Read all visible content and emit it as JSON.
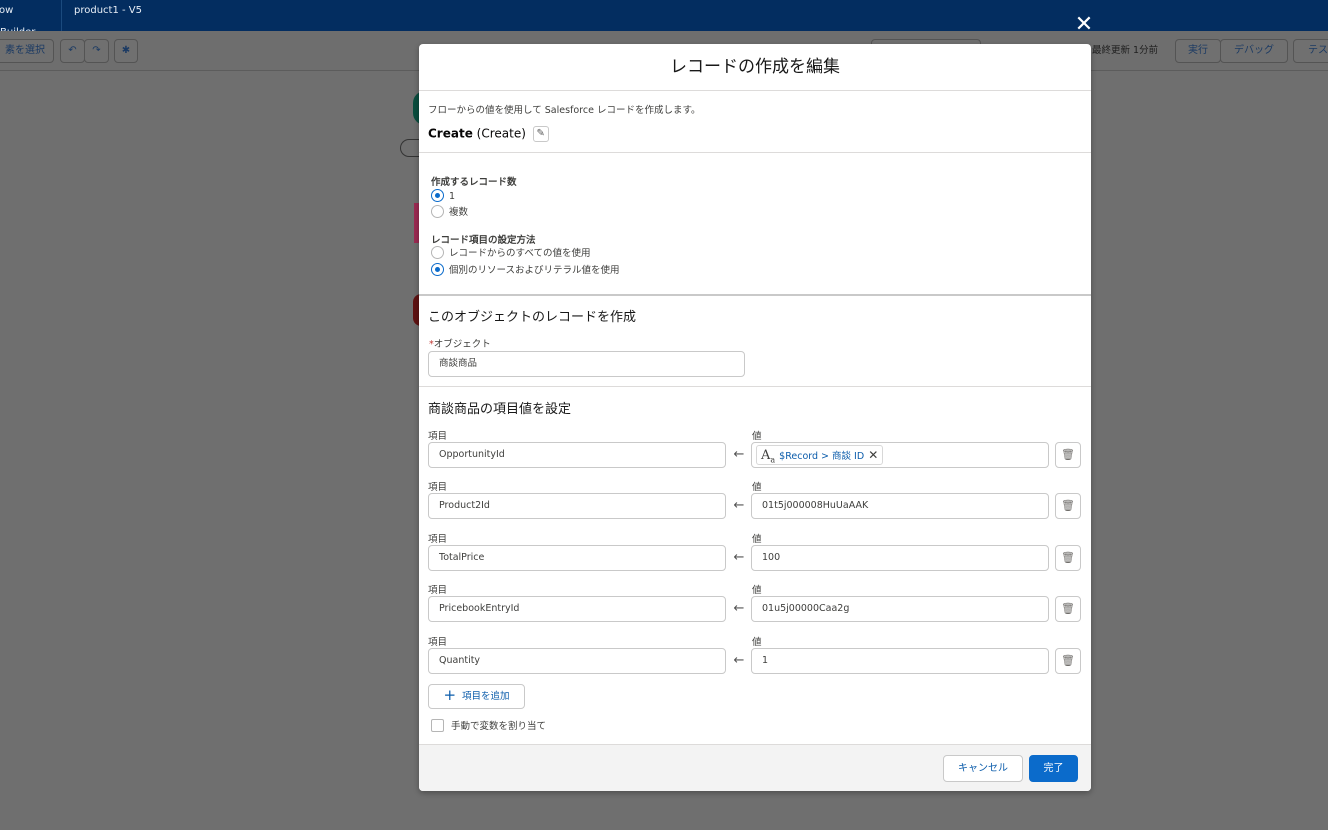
{
  "topbar": {
    "app_name": "ow Builder",
    "version": "product1 - V5"
  },
  "toolbar": {
    "select_label": "素を選択",
    "undo_icon": "undo-icon",
    "redo_icon": "redo-icon",
    "settings_icon": "gear-icon",
    "last_saved": "最終更新 1分前",
    "run_label": "実行",
    "debug_label": "デバッグ",
    "test_label": "テス"
  },
  "modal": {
    "title": "レコードの作成を編集",
    "description": "フローからの値を使用して Salesforce レコードを作成します。",
    "api_label": "Create",
    "api_name": "(Create)",
    "record_count": {
      "label": "作成するレコード数",
      "options": [
        {
          "label": "1",
          "selected": true
        },
        {
          "label": "複数",
          "selected": false
        }
      ]
    },
    "field_method": {
      "label": "レコード項目の設定方法",
      "options": [
        {
          "label": "レコードからのすべての値を使用",
          "selected": false
        },
        {
          "label": "個別のリソースおよびリテラル値を使用",
          "selected": true
        }
      ]
    },
    "object_section": {
      "title": "このオブジェクトのレコードを作成",
      "required_mark": "*",
      "object_label": "オブジェクト",
      "object_value": "商談商品"
    },
    "fields_section": {
      "title": "商談商品の項目値を設定",
      "field_header": "項目",
      "value_header": "値",
      "rows": [
        {
          "field": "OpportunityId",
          "value": "$Record > 商談 ID",
          "is_resource": true
        },
        {
          "field": "Product2Id",
          "value": "01t5j000008HuUaAAK",
          "is_resource": false
        },
        {
          "field": "TotalPrice",
          "value": "100",
          "is_resource": false
        },
        {
          "field": "PricebookEntryId",
          "value": "01u5j00000Caa2g",
          "is_resource": false
        },
        {
          "field": "Quantity",
          "value": "1",
          "is_resource": false
        }
      ]
    },
    "add_field_label": "項目を追加",
    "manual_assign_label": "手動で変数を割り当て",
    "cancel_label": "キャンセル",
    "done_label": "完了"
  },
  "colors": {
    "brand": "#0b6bcb",
    "header_bg": "#032d60"
  }
}
